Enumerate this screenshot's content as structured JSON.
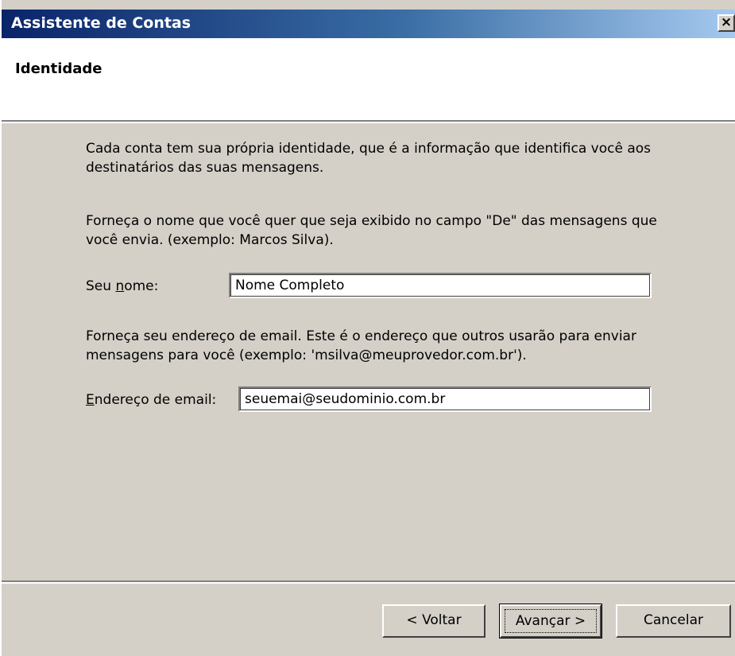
{
  "window": {
    "title": "Assistente de Contas",
    "close_glyph": "×"
  },
  "header": {
    "title": "Identidade"
  },
  "main": {
    "intro": "Cada conta tem sua própria identidade, que é a informação que identifica você aos destinatários das suas mensagens.",
    "name_instructions": "Forneça o nome que você quer que seja exibido no campo \"De\" das mensagens que você envia. (exemplo: Marcos Silva).",
    "name_label_pre": "Seu ",
    "name_label_accel": "n",
    "name_label_post": "ome:",
    "name_value": "Nome Completo",
    "email_instructions": "Forneça seu endereço de email. Este é o endereço que outros usarão para enviar mensagens para você (exemplo: 'msilva@meuprovedor.com.br').",
    "email_label_accel": "E",
    "email_label_post": "ndereço de email:",
    "email_value": "seuemai@seudominio.com.br"
  },
  "footer": {
    "back_label": "< Voltar",
    "next_label": "Avançar >",
    "cancel_label": "Cancelar"
  },
  "colors": {
    "dialog_bg": "#d4d0c8",
    "title_gradient_start": "#0a246a",
    "title_gradient_end": "#a6caf0"
  }
}
